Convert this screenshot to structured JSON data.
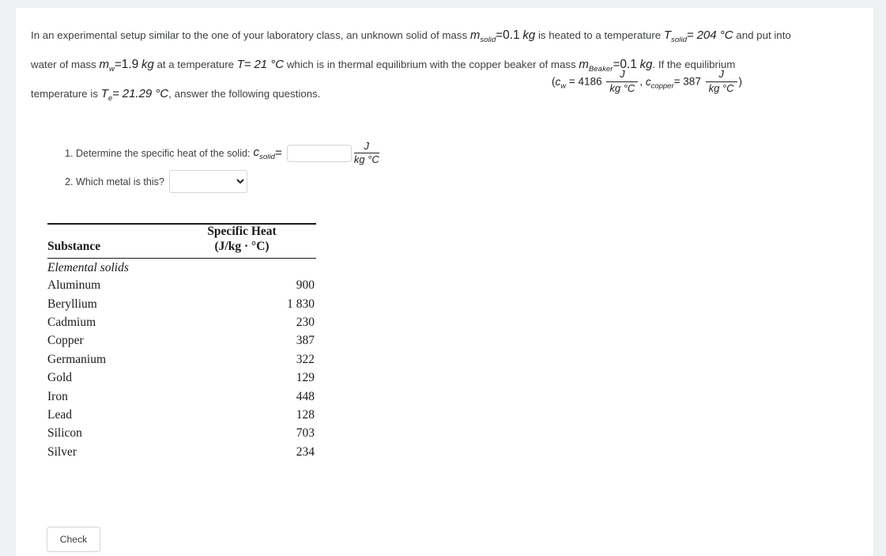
{
  "problem": {
    "line1_a": "In an experimental setup similar to the one of your laboratory class, an unknown solid of mass",
    "m_solid_sym": "m",
    "m_solid_sub": "solid",
    "m_solid_eq": "=",
    "m_solid_val": "0.1",
    "m_solid_unit": "kg",
    "line1_b": "is heated to a temperature",
    "T_solid_sym": "T",
    "T_solid_sub": "solid",
    "T_solid_eq": "=",
    "T_solid_val": "204 °C",
    "line1_c": "and put into",
    "line2_a": "water of mass",
    "m_w_sym": "m",
    "m_w_sub": "w",
    "m_w_eq": "=",
    "m_w_val": "1.9",
    "m_w_unit": "kg",
    "line2_b": "at a temperature",
    "T_sym": "T",
    "T_eq": "=",
    "T_val": "21 °C",
    "line2_c": "which is in thermal equilibrium with the copper beaker of mass",
    "m_beaker_sym": "m",
    "m_beaker_sub": "Beaker",
    "m_beaker_eq": "=",
    "m_beaker_val": "0.1",
    "m_beaker_unit": "kg",
    "line2_d": ". If the equilibrium",
    "line3_a": "temperature is",
    "Te_sym": "T",
    "Te_sub": "e",
    "Te_eq": "=",
    "Te_val": "21.29 °C",
    "line3_b": ", answer the following questions."
  },
  "constants": {
    "open_paren": "(",
    "cw_sym": "c",
    "cw_sub": "w",
    "cw_eq": "=",
    "cw_val": "4186",
    "cw_numerator": "J",
    "cw_denominator": "kg °C",
    "separator": ",",
    "ccopper_sym": "c",
    "ccopper_sub": "copper",
    "ccopper_eq": "=",
    "ccopper_val": "387",
    "ccopper_numerator": "J",
    "ccopper_denominator": "kg °C",
    "close_paren": ")"
  },
  "questions": {
    "q1": {
      "text": "1. Determine the specific heat of the solid:",
      "symbol": "c",
      "subscript": "solid",
      "equals": "=",
      "input_value": "",
      "input_placeholder": "",
      "unit_numerator": "J",
      "unit_denominator": "kg °C"
    },
    "q2": {
      "text": "2. Which metal is this?",
      "selected": "",
      "options": [
        "",
        "Aluminum",
        "Beryllium",
        "Cadmium",
        "Copper",
        "Germanium",
        "Gold",
        "Iron",
        "Lead",
        "Silicon",
        "Silver"
      ]
    }
  },
  "table": {
    "header_substance": "Substance",
    "header_heat_line1": "Specific Heat",
    "header_heat_line2": "(J/kg · °C)",
    "group_label": "Elemental solids",
    "rows": [
      {
        "name": "Aluminum",
        "value": "900"
      },
      {
        "name": "Beryllium",
        "value": "1 830"
      },
      {
        "name": "Cadmium",
        "value": "230"
      },
      {
        "name": "Copper",
        "value": "387"
      },
      {
        "name": "Germanium",
        "value": "322"
      },
      {
        "name": "Gold",
        "value": "129"
      },
      {
        "name": "Iron",
        "value": "448"
      },
      {
        "name": "Lead",
        "value": "128"
      },
      {
        "name": "Silicon",
        "value": "703"
      },
      {
        "name": "Silver",
        "value": "234"
      }
    ]
  },
  "actions": {
    "check_label": "Check"
  }
}
